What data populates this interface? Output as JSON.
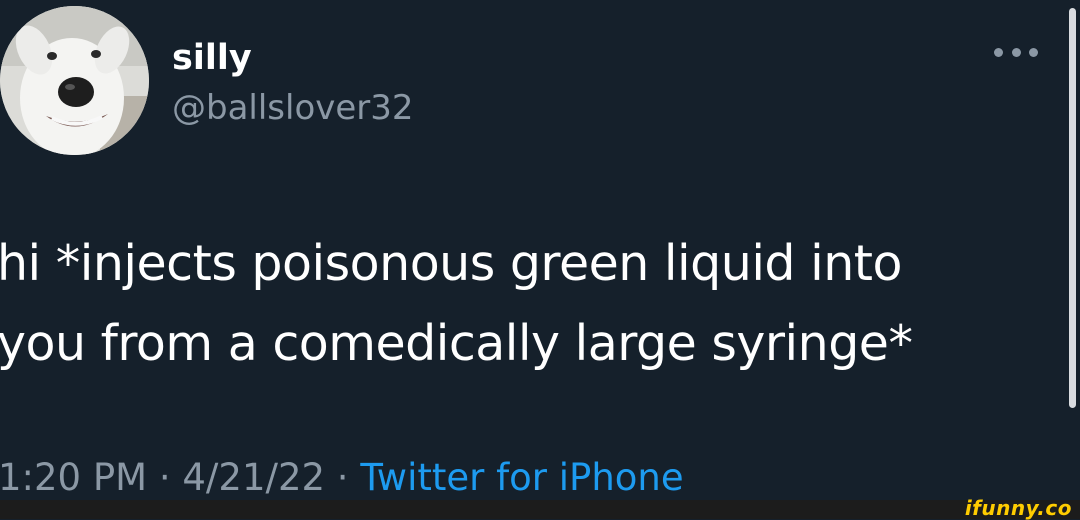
{
  "tweet": {
    "display_name": "silly",
    "handle": "@ballslover32",
    "more_icon": "more-horizontal-icon",
    "text_line_1": "hi *injects poisonous green liquid into",
    "text_line_2": "you from a comedically large syringe*",
    "time": "1:20 PM",
    "separator": " · ",
    "date": "4/21/22",
    "source": "Twitter for iPhone"
  },
  "watermark": {
    "text": "ifunny.co"
  },
  "colors": {
    "background": "#15202b",
    "primary_text": "#ffffff",
    "secondary_text": "#8b98a5",
    "link": "#1d9bf0",
    "watermark": "#ffcc00"
  }
}
